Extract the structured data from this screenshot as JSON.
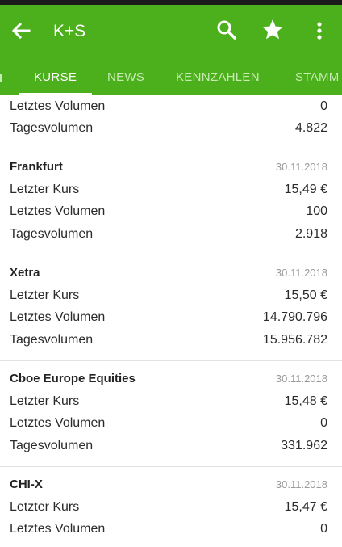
{
  "app": {
    "title": "K+S",
    "accent": "#4caf1c"
  },
  "icons": {
    "back": "arrow-left-icon",
    "search": "magnifier-icon",
    "favorite": "star-icon",
    "more": "vertical-dots-icon"
  },
  "tabs": [
    {
      "label": "KURSE",
      "active": true
    },
    {
      "label": "NEWS",
      "active": false
    },
    {
      "label": "KENNZAHLEN",
      "active": false
    },
    {
      "label": "STAMM",
      "active": false
    }
  ],
  "top_partial": {
    "rows": [
      {
        "label": "Letztes Volumen",
        "value": "0"
      },
      {
        "label": "Tagesvolumen",
        "value": "4.822"
      }
    ]
  },
  "exchanges": [
    {
      "name": "Frankfurt",
      "date": "30.11.2018",
      "rows": [
        {
          "label": "Letzter Kurs",
          "value": "15,49 €"
        },
        {
          "label": "Letztes Volumen",
          "value": "100"
        },
        {
          "label": "Tagesvolumen",
          "value": "2.918"
        }
      ]
    },
    {
      "name": "Xetra",
      "date": "30.11.2018",
      "rows": [
        {
          "label": "Letzter Kurs",
          "value": "15,50 €"
        },
        {
          "label": "Letztes Volumen",
          "value": "14.790.796"
        },
        {
          "label": "Tagesvolumen",
          "value": "15.956.782"
        }
      ]
    },
    {
      "name": "Cboe Europe Equities",
      "date": "30.11.2018",
      "rows": [
        {
          "label": "Letzter Kurs",
          "value": "15,48 €"
        },
        {
          "label": "Letztes Volumen",
          "value": "0"
        },
        {
          "label": "Tagesvolumen",
          "value": "331.962"
        }
      ]
    },
    {
      "name": "CHI-X",
      "date": "30.11.2018",
      "rows": [
        {
          "label": "Letzter Kurs",
          "value": "15,47 €"
        },
        {
          "label": "Letztes Volumen",
          "value": "0"
        }
      ]
    }
  ]
}
